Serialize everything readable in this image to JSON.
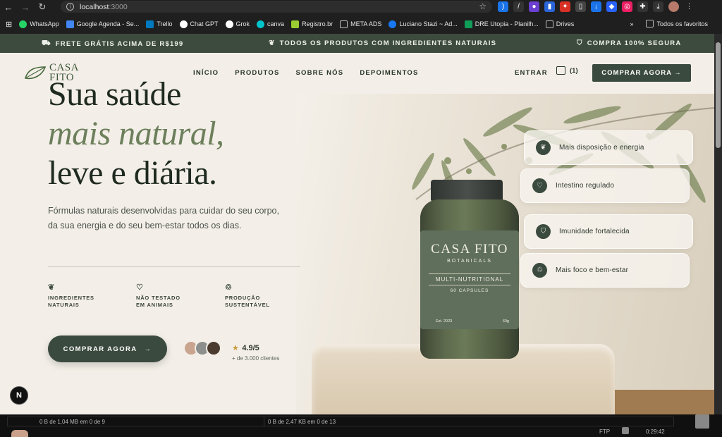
{
  "browser": {
    "url_host": "localhost",
    "url_port": ":3000",
    "bookmarks": [
      {
        "label": "WhatsApp",
        "color": "#25d366"
      },
      {
        "label": "Google Agenda - Se...",
        "color": "#4285f4"
      },
      {
        "label": "Trello",
        "color": "#0079bf"
      },
      {
        "label": "Chat GPT",
        "color": "#ffffff"
      },
      {
        "label": "Grok",
        "color": "#ffffff"
      },
      {
        "label": "canva",
        "color": "#00c4cc"
      },
      {
        "label": "Registro.br",
        "color": "#9acd32"
      },
      {
        "label": "META ADS",
        "color": "#bbbbbb"
      },
      {
        "label": "Luciano Stazi ~ Ad...",
        "color": "#1877f2"
      },
      {
        "label": "DRE Utopia - Planilh...",
        "color": "#0f9d58"
      },
      {
        "label": "Drives",
        "color": "#bbbbbb"
      }
    ],
    "bookmarks_more": "»",
    "all_favorites": "Todos os favoritos"
  },
  "promo": {
    "left": "FRETE GRÁTIS ACIMA DE R$199",
    "center": "TODOS OS PRODUTOS COM INGREDIENTES NATURAIS",
    "right": "COMPRA 100% SEGURA"
  },
  "header": {
    "logo_line1": "CASA",
    "logo_line2": "FITO",
    "nav": [
      "INÍCIO",
      "PRODUTOS",
      "SOBRE NÓS",
      "DEPOIMENTOS"
    ],
    "login": "ENTRAR",
    "cart_count": "(1)",
    "buy_button": "COMPRAR AGORA →"
  },
  "hero": {
    "line1": "Sua saúde",
    "line2": "mais natural,",
    "line3": "leve e diária.",
    "lead": "Fórmulas naturais desenvolvidas para cuidar do seu corpo, da sua energia e do seu bem-estar todos os dias.",
    "features": [
      {
        "l1": "INGREDIENTES",
        "l2": "NATURAIS"
      },
      {
        "l1": "NÃO TESTADO",
        "l2": "EM ANIMAIS"
      },
      {
        "l1": "PRODUÇÃO",
        "l2": "SUSTENTÁVEL"
      }
    ],
    "cta": "COMPRAR AGORA",
    "rating_value": "4.9/5",
    "rating_sub": "+ de 3.000 clientes"
  },
  "product": {
    "brand": "CASA FITO",
    "sub": "BOTANICALS",
    "name": "MULTI-NUTRITIONAL",
    "count": "60 CAPSULES",
    "est": "Est. 2023",
    "weight": "60g"
  },
  "cards": [
    "Mais disposição e energia",
    "Intestino regulado",
    "Imunidade fortalecida",
    "Mais foco e bem-estar"
  ],
  "status": {
    "left": "0 B de 1,04 MB em 0 de 9",
    "right": "0 B de 2,47 KB em 0 de 13",
    "ftp": "FTP",
    "clock": "0:29:42"
  }
}
